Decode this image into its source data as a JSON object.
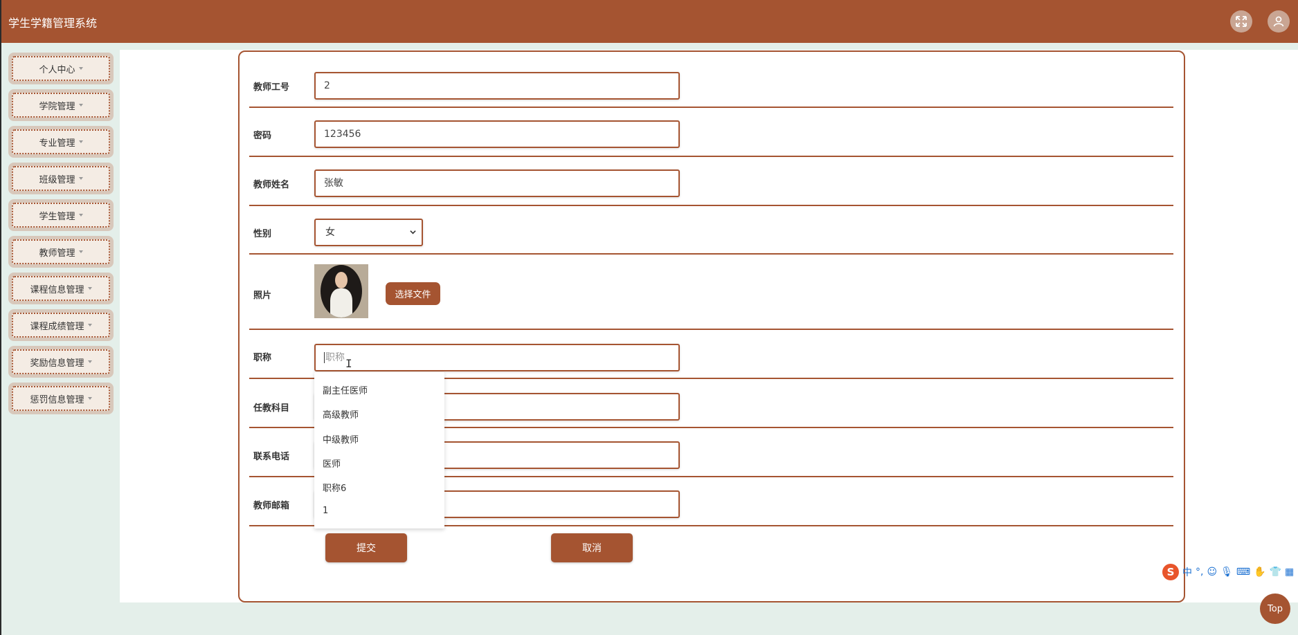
{
  "header": {
    "app_title": "学生学籍管理系统",
    "fullscreen_icon": "fullscreen-icon",
    "user_icon": "user-icon"
  },
  "sidebar": {
    "items": [
      {
        "label": "个人中心"
      },
      {
        "label": "学院管理"
      },
      {
        "label": "专业管理"
      },
      {
        "label": "班级管理"
      },
      {
        "label": "学生管理"
      },
      {
        "label": "教师管理"
      },
      {
        "label": "课程信息管理"
      },
      {
        "label": "课程成绩管理"
      },
      {
        "label": "奖励信息管理"
      },
      {
        "label": "惩罚信息管理"
      }
    ]
  },
  "form": {
    "teacher_id": {
      "label": "教师工号",
      "value": "2"
    },
    "password": {
      "label": "密码",
      "value": "123456"
    },
    "teacher_name": {
      "label": "教师姓名",
      "value": "张敏"
    },
    "gender": {
      "label": "性别",
      "value": "女"
    },
    "photo": {
      "label": "照片",
      "button_label": "选择文件"
    },
    "title": {
      "label": "职称",
      "placeholder": "职称"
    },
    "subject": {
      "label": "任教科目",
      "value": ""
    },
    "phone": {
      "label": "联系电话",
      "value": ""
    },
    "email": {
      "label": "教师邮箱",
      "value": ""
    },
    "title_suggestions": [
      "副主任医师",
      "高级教师",
      "中级教师",
      "医师",
      "职称6",
      "1"
    ],
    "submit_label": "提交",
    "cancel_label": "取消"
  },
  "ime": {
    "logo": "S",
    "mode": "中",
    "punct": "°,",
    "items": [
      "smiley-icon",
      "mic-icon",
      "keyboard-icon",
      "tools-icon",
      "shirt-icon",
      "grid-icon"
    ]
  },
  "top_button": {
    "label": "Top"
  },
  "colors": {
    "accent": "#a55431",
    "background": "#e4efea"
  }
}
